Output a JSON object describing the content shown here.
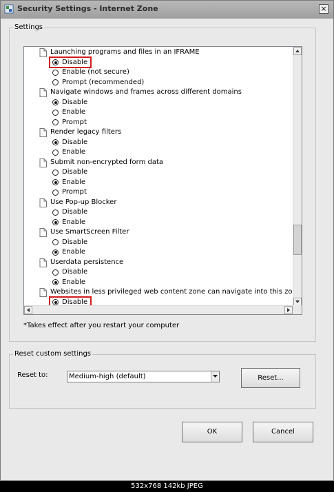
{
  "window": {
    "title": "Security Settings - Internet Zone",
    "close_label": "×"
  },
  "settings_group": {
    "label": "Settings",
    "rows": [
      {
        "kind": "header",
        "text": "Launching programs and files in an IFRAME"
      },
      {
        "kind": "option",
        "text": "Disable",
        "selected": true,
        "highlighted": true
      },
      {
        "kind": "option",
        "text": "Enable (not secure)",
        "selected": false
      },
      {
        "kind": "option",
        "text": "Prompt (recommended)",
        "selected": false
      },
      {
        "kind": "header",
        "text": "Navigate windows and frames across different domains"
      },
      {
        "kind": "option",
        "text": "Disable",
        "selected": true
      },
      {
        "kind": "option",
        "text": "Enable",
        "selected": false
      },
      {
        "kind": "option",
        "text": "Prompt",
        "selected": false
      },
      {
        "kind": "header",
        "text": "Render legacy filters"
      },
      {
        "kind": "option",
        "text": "Disable",
        "selected": true
      },
      {
        "kind": "option",
        "text": "Enable",
        "selected": false
      },
      {
        "kind": "header",
        "text": "Submit non-encrypted form data"
      },
      {
        "kind": "option",
        "text": "Disable",
        "selected": false
      },
      {
        "kind": "option",
        "text": "Enable",
        "selected": true
      },
      {
        "kind": "option",
        "text": "Prompt",
        "selected": false
      },
      {
        "kind": "header",
        "text": "Use Pop-up Blocker"
      },
      {
        "kind": "option",
        "text": "Disable",
        "selected": false
      },
      {
        "kind": "option",
        "text": "Enable",
        "selected": true
      },
      {
        "kind": "header",
        "text": "Use SmartScreen Filter"
      },
      {
        "kind": "option",
        "text": "Disable",
        "selected": false
      },
      {
        "kind": "option",
        "text": "Enable",
        "selected": true
      },
      {
        "kind": "header",
        "text": "Userdata persistence"
      },
      {
        "kind": "option",
        "text": "Disable",
        "selected": false
      },
      {
        "kind": "option",
        "text": "Enable",
        "selected": true
      },
      {
        "kind": "header",
        "text": "Websites in less privileged web content zone can navigate into this zone"
      },
      {
        "kind": "option",
        "text": "Disable",
        "selected": true,
        "highlighted": true
      }
    ],
    "note": "*Takes effect after you restart your computer"
  },
  "reset_group": {
    "label": "Reset custom settings",
    "reset_to_label": "Reset to:",
    "selected_value": "Medium-high (default)",
    "reset_button": "Reset..."
  },
  "footer": {
    "ok_button": "OK",
    "cancel_button": "Cancel"
  },
  "image_info": {
    "text": "532x768  142kb  JPEG"
  },
  "colors": {
    "highlight": "#d21a1a",
    "dialog_bg": "#e9e9e9"
  }
}
